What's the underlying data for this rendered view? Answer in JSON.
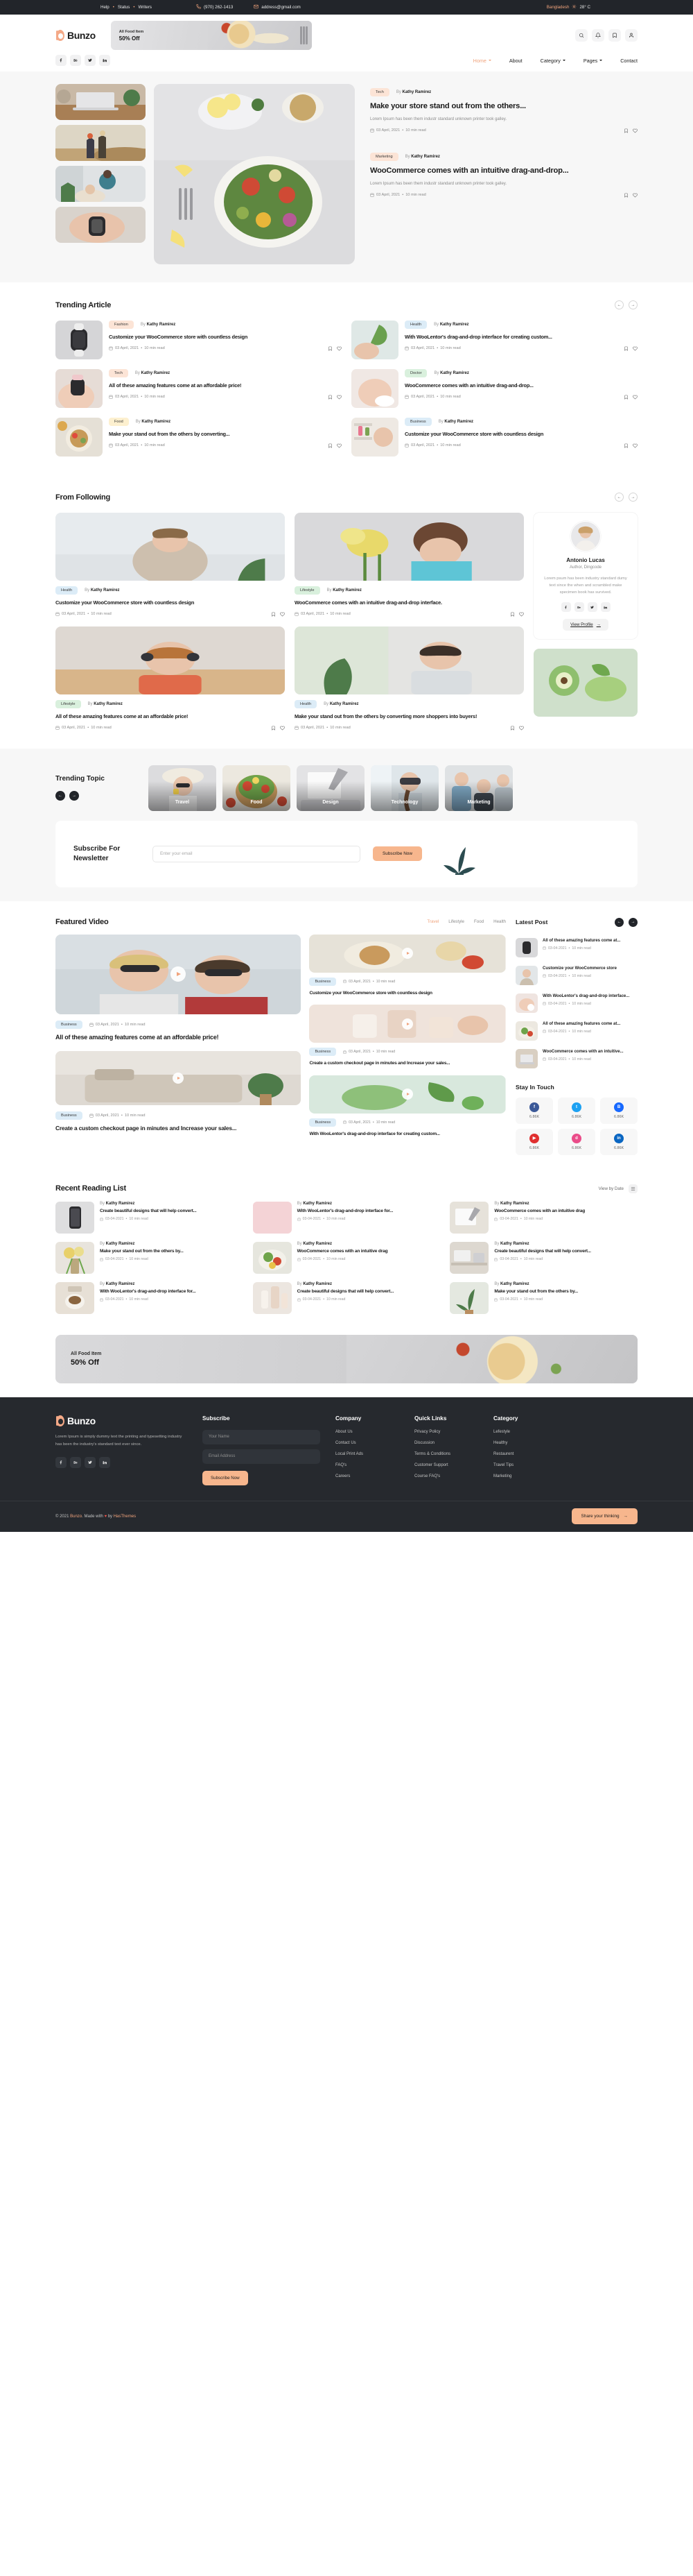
{
  "topbar": {
    "links": [
      "Help",
      "Status",
      "Writers"
    ],
    "phone": "(970) 262-1413",
    "email": "address@gmail.com",
    "location": "Bangladesh",
    "temperature": "28° C",
    "phone_icon": "phone-icon",
    "email_icon": "envelope-icon",
    "weather_icon": "sun-icon"
  },
  "header": {
    "brand": "Bunzo",
    "promo": {
      "line1": "All Food Item",
      "line2": "50% Off"
    },
    "icons": [
      "search-icon",
      "bell-icon",
      "bookmark-icon",
      "user-icon"
    ],
    "socials": [
      "facebook-icon",
      "behance-icon",
      "twitter-icon",
      "linkedin-icon"
    ],
    "nav": [
      {
        "label": "Home",
        "active": true,
        "caret": true
      },
      {
        "label": "About",
        "active": false,
        "caret": false
      },
      {
        "label": "Category",
        "active": false,
        "caret": true
      },
      {
        "label": "Pages",
        "active": false,
        "caret": true
      },
      {
        "label": "Contact",
        "active": false,
        "caret": false
      }
    ]
  },
  "hero": {
    "thumbs": [
      "laptop-desk",
      "hikers-sunset",
      "doctor-patient",
      "smartwatch-wrist"
    ],
    "main_image": "salad-bowl-table",
    "posts": [
      {
        "category": "Tech",
        "cat_class": "tech",
        "author": "Kathy Ramirez",
        "title": "Make your store stand out from the others...",
        "desc": "Lorem Ipsum has been them industr standard unknown printer took galley.",
        "date": "03 April, 2021",
        "read": "10 min read"
      },
      {
        "category": "Marketing",
        "cat_class": "marketing",
        "author": "Kathy Ramirez",
        "title": "WooCommerce comes with an intuitive drag-and-drop...",
        "desc": "Lorem Ipsum has been them industr standard unknown printer took galley.",
        "date": "03 April, 2021",
        "read": "10 min read"
      }
    ]
  },
  "trending_article": {
    "title": "Trending Article",
    "left": [
      {
        "category": "Fashion",
        "cat_class": "fashion",
        "author": "Kathy Ramirez",
        "title": "Customize your WooCommerce store with countless design",
        "date": "03 April, 2021",
        "read": "10 min read",
        "image": "smartwatch-white"
      },
      {
        "category": "Tech",
        "cat_class": "tech",
        "author": "Kathy Ramirez",
        "title": "All of these amazing features come at an affordable price!",
        "date": "03 April, 2021",
        "read": "10 min read",
        "image": "watch-on-wrist"
      },
      {
        "category": "Food",
        "cat_class": "food",
        "author": "Kathy Ramirez",
        "title": "Make your stand out from the others by converting...",
        "date": "03 April, 2021",
        "read": "10 min read",
        "image": "breakfast-bowl"
      }
    ],
    "right": [
      {
        "category": "Health",
        "cat_class": "health",
        "author": "Kathy Ramirez",
        "title": "With WooLentor's drag-and-drop interface for creating custom...",
        "date": "03 April, 2021",
        "read": "10 min read",
        "image": "hand-leaf"
      },
      {
        "category": "Doctor",
        "cat_class": "doctor",
        "author": "Kathy Ramirez",
        "title": "WooCommerce comes with an intuitive drag-and-drop...",
        "date": "03 April, 2021",
        "read": "10 min read",
        "image": "skincare-hands"
      },
      {
        "category": "Business",
        "cat_class": "business",
        "author": "Kathy Ramirez",
        "title": "Customize your WooCommerce store with countless design",
        "date": "03 April, 2021",
        "read": "10 min read",
        "image": "woman-shelf"
      }
    ]
  },
  "from_following": {
    "title": "From Following",
    "cards": [
      {
        "category": "Health",
        "cat_class": "health",
        "author": "Kathy Ramirez",
        "title": "Customize your WooCommerce store with countless design",
        "date": "03 April, 2021",
        "read": "10 min read",
        "image": "woman-meditating"
      },
      {
        "category": "Lifestyle",
        "cat_class": "lifestyle",
        "author": "Kathy Ramirez",
        "title": "WooCommerce comes with an intuitive drag-and-drop interface.",
        "date": "03 April, 2021",
        "read": "10 min read",
        "image": "girl-flowers"
      },
      {
        "category": "Lifestyle",
        "cat_class": "lifestyle",
        "author": "Kathy Ramirez",
        "title": "All of these amazing features come at an affordable price!",
        "date": "03 April, 2021",
        "read": "10 min read",
        "image": "woman-headphones"
      },
      {
        "category": "Health",
        "cat_class": "health",
        "author": "Kathy Ramirez",
        "title": "Make your stand out from the others by converting more shoppers into buyers!",
        "date": "03 April, 2021",
        "read": "10 min read",
        "image": "woman-laptop-plant"
      }
    ],
    "author": {
      "name": "Antonio Lucas",
      "role": "Author, Dingcode",
      "bio": "Lorem psum has been industry standard dumy text since the when and scrambled make specimen book has survived.",
      "socials": [
        "facebook-icon",
        "behance-icon",
        "twitter-icon",
        "linkedin-icon"
      ],
      "cta": "View Profile",
      "avatar": "woman-portrait"
    },
    "side_image": "avocado-cucumber"
  },
  "trending_topic": {
    "title": "Trending Topic",
    "topics": [
      {
        "label": "Travel",
        "image": "woman-hat-sunglasses"
      },
      {
        "label": "Food",
        "image": "salad-bowl"
      },
      {
        "label": "Design",
        "image": "hands-notebook"
      },
      {
        "label": "Technology",
        "image": "vr-headset-woman"
      },
      {
        "label": "Marketing",
        "image": "team-meeting"
      }
    ]
  },
  "newsletter": {
    "title": "Subscribe For Newsletter",
    "placeholder": "Enter your email",
    "button": "Subscribe Now"
  },
  "featured_video": {
    "title": "Featured Video",
    "tabs": [
      {
        "label": "Travel",
        "active": true
      },
      {
        "label": "Lifestyle",
        "active": false
      },
      {
        "label": "Food",
        "active": false
      },
      {
        "label": "Health",
        "active": false
      }
    ],
    "big": {
      "image": "couple-sunglasses-selfie",
      "category": "Business",
      "date": "03 April, 2021",
      "read": "10 min read",
      "title": "All of these amazing features come at an affordable price!"
    },
    "big2": {
      "image": "living-room-sofa",
      "category": "Business",
      "date": "03 April, 2021",
      "read": "10 min read",
      "title": "Create a custom checkout page in minutes and Increase your sales..."
    },
    "small1": {
      "image": "breakfast-pancakes",
      "category": "Business",
      "date": "03 April, 2021",
      "read": "10 min read",
      "title": "Customize your WooCommerce store with countless design"
    },
    "small2": {
      "image": "skincare-products",
      "category": "Business",
      "date": "03 April, 2021",
      "read": "10 min read",
      "title": "Create a custom checkout page in minutes and Increase your sales..."
    },
    "small3": {
      "image": "green-leaves-water",
      "category": "Business",
      "date": "03 April, 2021",
      "read": "10 min read",
      "title": "With WooLentor's drag-and-drop interface for creating custom..."
    }
  },
  "latest_post": {
    "title": "Latest Post",
    "items": [
      {
        "title": "All of these amazing features come at...",
        "date": "03-04-2021",
        "read": "10 min read",
        "image": "smartwatch"
      },
      {
        "title": "Customize your WooCommerce store",
        "date": "03-04-2021",
        "read": "10 min read",
        "image": "woman-yoga"
      },
      {
        "title": "With WooLentor's drag-and-drop interface...",
        "date": "03-04-2021",
        "read": "10 min read",
        "image": "hand-cream"
      },
      {
        "title": "All of these amazing features come at...",
        "date": "03-04-2021",
        "read": "10 min read",
        "image": "salad-plate"
      },
      {
        "title": "WooCommerce comes with an intuitive...",
        "date": "03-04-2021",
        "read": "10 min read",
        "image": "laptop-desk"
      }
    ]
  },
  "stay_in_touch": {
    "title": "Stay In Touch",
    "items": [
      {
        "icon": "facebook-icon",
        "count": "6.86K",
        "color": "#3b5998"
      },
      {
        "icon": "twitter-icon",
        "count": "6.86K",
        "color": "#1da1f2"
      },
      {
        "icon": "behance-icon",
        "count": "6.86K",
        "color": "#1769ff"
      },
      {
        "icon": "youtube-icon",
        "count": "6.86K",
        "color": "#e02f2f"
      },
      {
        "icon": "dribbble-icon",
        "count": "6.86K",
        "color": "#ea4c89"
      },
      {
        "icon": "linkedin-icon",
        "count": "6.86K",
        "color": "#0a66c2"
      }
    ]
  },
  "recent_reading": {
    "title": "Recent Reading List",
    "view_by": "View by Date",
    "items": [
      {
        "author": "Kathy Ramirez",
        "title": "Create beautiful designs that will help convert...",
        "date": "03-04-2021",
        "read": "10 min read",
        "image": "phone-mockup"
      },
      {
        "author": "Kathy Ramirez",
        "title": "With WooLentor's drag-and-drop interface for...",
        "date": "03-04-2021",
        "read": "10 min read",
        "image": "pink-blank"
      },
      {
        "author": "Kathy Ramirez",
        "title": "WooCommerce comes with an intuitive drag",
        "date": "03-04-2021",
        "read": "10 min read",
        "image": "notebook-pen"
      },
      {
        "author": "Kathy Ramirez",
        "title": "Make your stand out from the others by...",
        "date": "03-04-2021",
        "read": "10 min read",
        "image": "flowers-vase"
      },
      {
        "author": "Kathy Ramirez",
        "title": "WooCommerce comes with an intuitive drag",
        "date": "03-04-2021",
        "read": "10 min read",
        "image": "salad-fresh"
      },
      {
        "author": "Kathy Ramirez",
        "title": "Create beautiful designs that will help convert...",
        "date": "03-04-2021",
        "read": "10 min read",
        "image": "office-desk"
      },
      {
        "author": "Kathy Ramirez",
        "title": "With WooLentor's drag-and-drop interface for...",
        "date": "03-04-2021",
        "read": "10 min read",
        "image": "coffee-cup"
      },
      {
        "author": "Kathy Ramirez",
        "title": "Create beautiful designs that will help convert...",
        "date": "03-04-2021",
        "read": "10 min read",
        "image": "cosmetic-bottles"
      },
      {
        "author": "Kathy Ramirez",
        "title": "Make your stand out from the others by...",
        "date": "03-04-2021",
        "read": "10 min read",
        "image": "green-plant"
      }
    ]
  },
  "banner": {
    "line1": "All Food Item",
    "line2": "50% Off",
    "image": "pasta-plate"
  },
  "footer": {
    "brand": "Bunzo",
    "desc": "Lorem Ipsum is simply dummy text the printing and typesetting industry has been the industry's standard text ever since.",
    "socials": [
      "facebook-icon",
      "behance-icon",
      "twitter-icon",
      "linkedin-icon"
    ],
    "subscribe": {
      "title": "Subscribe",
      "name_placeholder": "Your Name",
      "email_placeholder": "Email Address",
      "button": "Subscribe Now"
    },
    "columns": [
      {
        "title": "Company",
        "links": [
          "About Us",
          "Contact Us",
          "Local Print Ads",
          "FAQ's",
          "Careers"
        ]
      },
      {
        "title": "Quick Links",
        "links": [
          "Privacy Policy",
          "Discussion",
          "Terms & Conditions",
          "Customer Support",
          "Course FAQ's"
        ]
      },
      {
        "title": "Category",
        "links": [
          "Lefestyle",
          "Healthy",
          "Restaurent",
          "Travel Tips",
          "Marketing"
        ]
      }
    ],
    "copyright_pre": "© 2021 ",
    "copyright_brand": "Bunzo",
    "copyright_mid": ". Made with ",
    "copyright_heart": "♥",
    "copyright_by": " by ",
    "copyright_author": "HasThemes",
    "share_button": "Share your thinking"
  },
  "colors": {
    "accent": "#f0a37c",
    "accent_button": "#f7b68d",
    "dark": "#26292e",
    "page_bg": "#ffffff",
    "section_bg": "#f7f7f7"
  }
}
